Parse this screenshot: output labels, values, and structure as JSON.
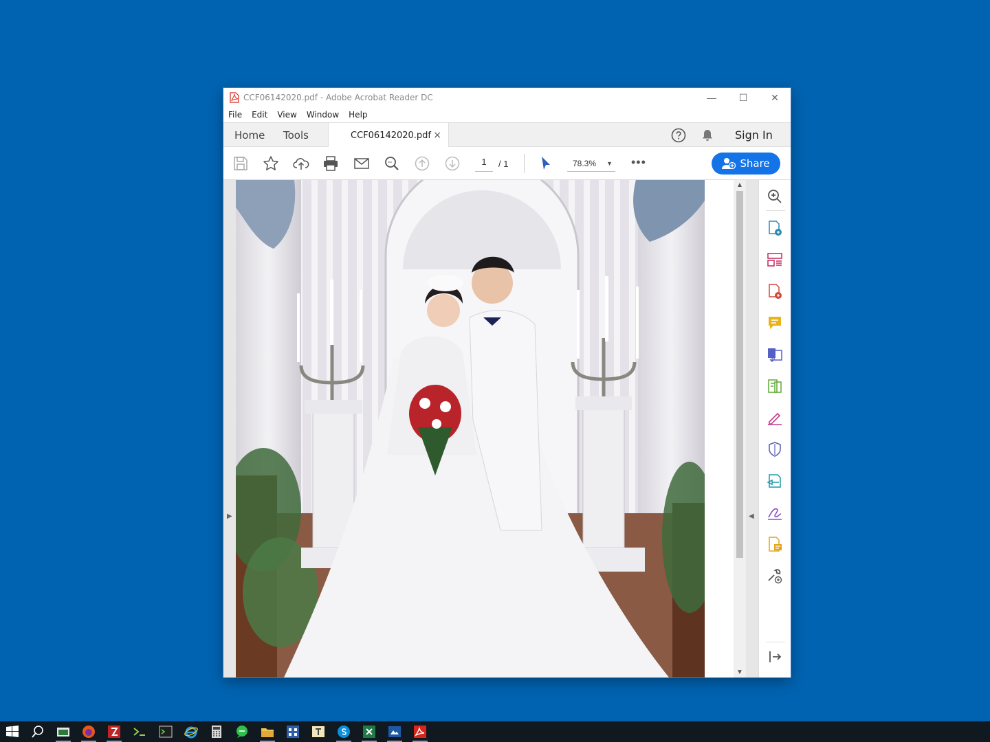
{
  "window": {
    "title": "CCF06142020.pdf - Adobe Acrobat Reader DC",
    "minimize": "—",
    "maximize": "☐",
    "close": "✕"
  },
  "menu": [
    "File",
    "Edit",
    "View",
    "Window",
    "Help"
  ],
  "tabs": {
    "home": "Home",
    "tools": "Tools",
    "document": "CCF06142020.pdf",
    "document_close": "×",
    "sign_in": "Sign In"
  },
  "toolbar": {
    "page_current": "1",
    "page_total": "/ 1",
    "zoom": "78.3%",
    "more": "•••",
    "share_label": "Share"
  },
  "colors": {
    "desktop": "#0063B1",
    "accent": "#1473E6",
    "taskbar": "#101820"
  },
  "right_panel_icons": [
    "zoom-icon",
    "create-pdf-icon",
    "organize-pages-icon",
    "export-pdf-icon",
    "comment-icon",
    "combine-files-icon",
    "compress-icon",
    "fill-sign-icon",
    "protect-icon",
    "send-review-icon",
    "request-signature-icon",
    "edit-pdf-icon",
    "more-tools-icon",
    "collapse-panel-icon"
  ],
  "taskbar_icons": [
    "start-icon",
    "search-icon",
    "app-1-icon",
    "firefox-icon",
    "filezilla-icon",
    "app-4-icon",
    "terminal-icon",
    "internet-explorer-icon",
    "calculator-icon",
    "chat-icon",
    "file-explorer-icon",
    "app-11-icon",
    "app-12-icon",
    "skype-icon",
    "excel-icon",
    "app-15-icon",
    "acrobat-icon"
  ]
}
